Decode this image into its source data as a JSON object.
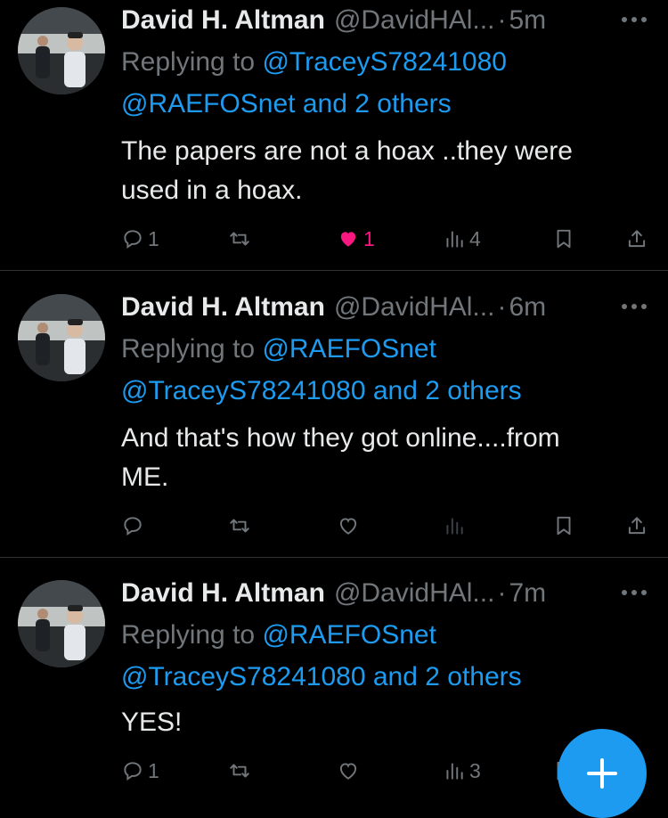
{
  "tweets": [
    {
      "author_name": "David H. Altman",
      "handle": "@DavidHAl...",
      "dot": "·",
      "time": "5m",
      "replying_prefix": "Replying to",
      "mention_1": "@TraceyS78241080",
      "mention_2": "@RAEFOSnet",
      "and_others": "and 2 others",
      "text_line1": "The papers are not a hoax ..they were",
      "text_line2": "used in a hoax.",
      "reply_count": "1",
      "retweet_count": "",
      "like_count": "1",
      "liked": true,
      "view_count": "4"
    },
    {
      "author_name": "David H. Altman",
      "handle": "@DavidHAl...",
      "dot": "·",
      "time": "6m",
      "replying_prefix": "Replying to",
      "mention_1": "@RAEFOSnet",
      "mention_2": "@TraceyS78241080",
      "and_others": "and 2 others",
      "text_line1": "And that's how they got online....from",
      "text_line2": "ME.",
      "reply_count": "",
      "retweet_count": "",
      "like_count": "",
      "liked": false,
      "view_count": ""
    },
    {
      "author_name": "David H. Altman",
      "handle": "@DavidHAl...",
      "dot": "·",
      "time": "7m",
      "replying_prefix": "Replying to",
      "mention_1": "@RAEFOSnet",
      "mention_2": "@TraceyS78241080",
      "and_others": "and 2 others",
      "text_line1": "YES!",
      "text_line2": "",
      "reply_count": "1",
      "retweet_count": "",
      "like_count": "",
      "liked": false,
      "view_count": "3"
    }
  ],
  "colors": {
    "background": "#000000",
    "text": "#e7e9ea",
    "muted": "#71767b",
    "link": "#1d9bf0",
    "like": "#f91880",
    "divider": "#2f3336"
  },
  "icons": {
    "reply": "reply-icon",
    "retweet": "retweet-icon",
    "like": "heart-icon",
    "views": "views-icon",
    "bookmark": "bookmark-icon",
    "share": "share-icon",
    "more": "more-icon",
    "compose": "plus-icon"
  }
}
